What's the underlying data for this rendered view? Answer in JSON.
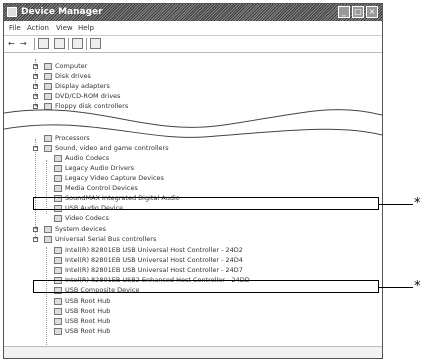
{
  "window": {
    "title": "Device Manager",
    "controls": {
      "minimize": "_",
      "maximize": "□",
      "close": "×"
    }
  },
  "menu": [
    "File",
    "Action",
    "View",
    "Help"
  ],
  "toolbar": {
    "back_symbol": "←",
    "forward_symbol": "→",
    "icons": [
      "properties-icon",
      "print-icon",
      "help-icon",
      "scan-icon"
    ]
  },
  "tree": {
    "top_nodes": [
      "Computer",
      "Disk drives",
      "Display adapters",
      "DVD/CD-ROM drives",
      "Floppy disk controllers"
    ],
    "processors": "Processors",
    "sound": {
      "label": "Sound, video and game controllers",
      "children": [
        "Audio Codecs",
        "Legacy Audio Drivers",
        "Legacy Video Capture Devices",
        "Media Control Devices",
        "SoundMAX Integrated Digital Audio",
        "USB Audio Device",
        "Video Codecs"
      ]
    },
    "system_devices": "System devices",
    "usb": {
      "label": "Universal Serial Bus controllers",
      "children": [
        "Intel(R) 82801EB USB Universal Host Controller - 24D2",
        "Intel(R) 82801EB USB Universal Host Controller - 24D4",
        "Intel(R) 82801EB USB Universal Host Controller - 24D7",
        "Intel(R) 82801EB USB2 Enhanced Host Controller - 24DD",
        "USB Composite Device",
        "USB Root Hub",
        "USB Root Hub",
        "USB Root Hub",
        "USB Root Hub"
      ]
    }
  },
  "annotations": {
    "marker": "*"
  }
}
